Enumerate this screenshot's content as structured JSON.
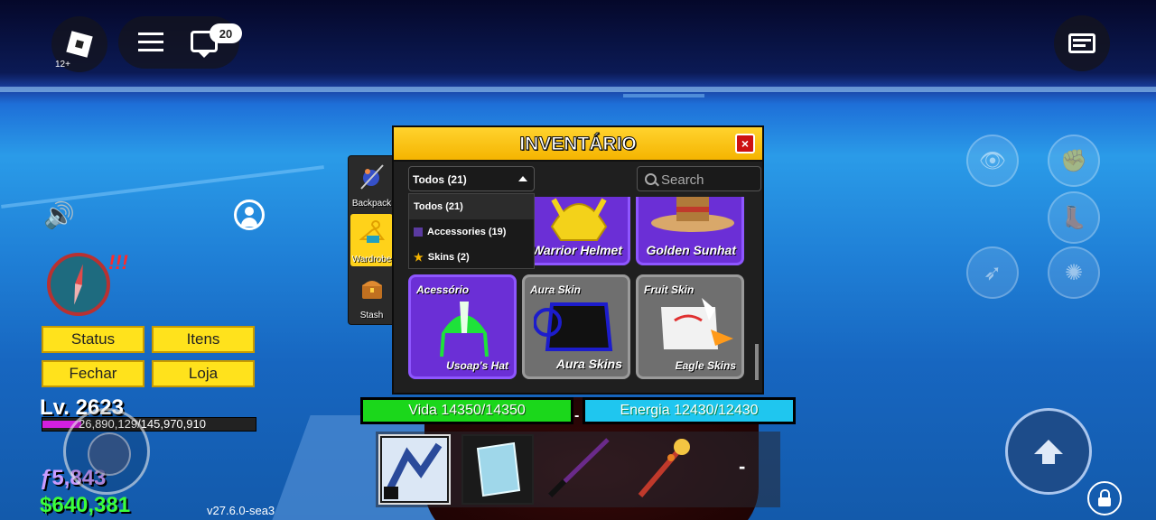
{
  "hud": {
    "age_rating": "12+",
    "chat_badge": "20",
    "alert": "!!!",
    "buttons": {
      "status": "Status",
      "itens": "Itens",
      "fechar": "Fechar",
      "loja": "Loja"
    },
    "level": "Lv. 2623",
    "xp": {
      "text": "26,890,129/145,970,910",
      "fraction": 0.184
    },
    "fragments": "ƒ5,843",
    "money": "$640,381",
    "version": "v27.6.0-sea3"
  },
  "sidetabs": [
    {
      "label": "Backpack",
      "active": false
    },
    {
      "label": "Wardrobe",
      "active": true
    },
    {
      "label": "Stash",
      "active": false
    }
  ],
  "inventory": {
    "title": "INVENTÁRIO",
    "close": "×",
    "filter_selected": "Todos (21)",
    "filter_options": [
      "Todos (21)",
      "Accessories (19)",
      "Skins (2)"
    ],
    "search_placeholder": "Search",
    "items": [
      {
        "tag": "",
        "name": "Warrior Helmet",
        "rarity_color": "#6b2fd6"
      },
      {
        "tag": "",
        "name": "Golden Sunhat",
        "rarity_color": "#6b2fd6"
      },
      {
        "tag": "Acessório",
        "name": "Usoap's Hat",
        "rarity_color": "#6b2fd6"
      },
      {
        "tag": "Aura Skin",
        "name": "Aura Skins",
        "rarity_color": "#6f6f6f"
      },
      {
        "tag": "Fruit Skin",
        "name": "Eagle Skins",
        "rarity_color": "#6f6f6f"
      }
    ]
  },
  "bars": {
    "health": "Vida 14350/14350",
    "energy": "Energia 12430/12430",
    "separator": "-"
  },
  "hotbar": {
    "empty_label": "-"
  },
  "colors": {
    "health": "#1bd71b",
    "energy": "#1fc6ef",
    "accent": "#ffd21a",
    "xp": "#d21fe0"
  }
}
